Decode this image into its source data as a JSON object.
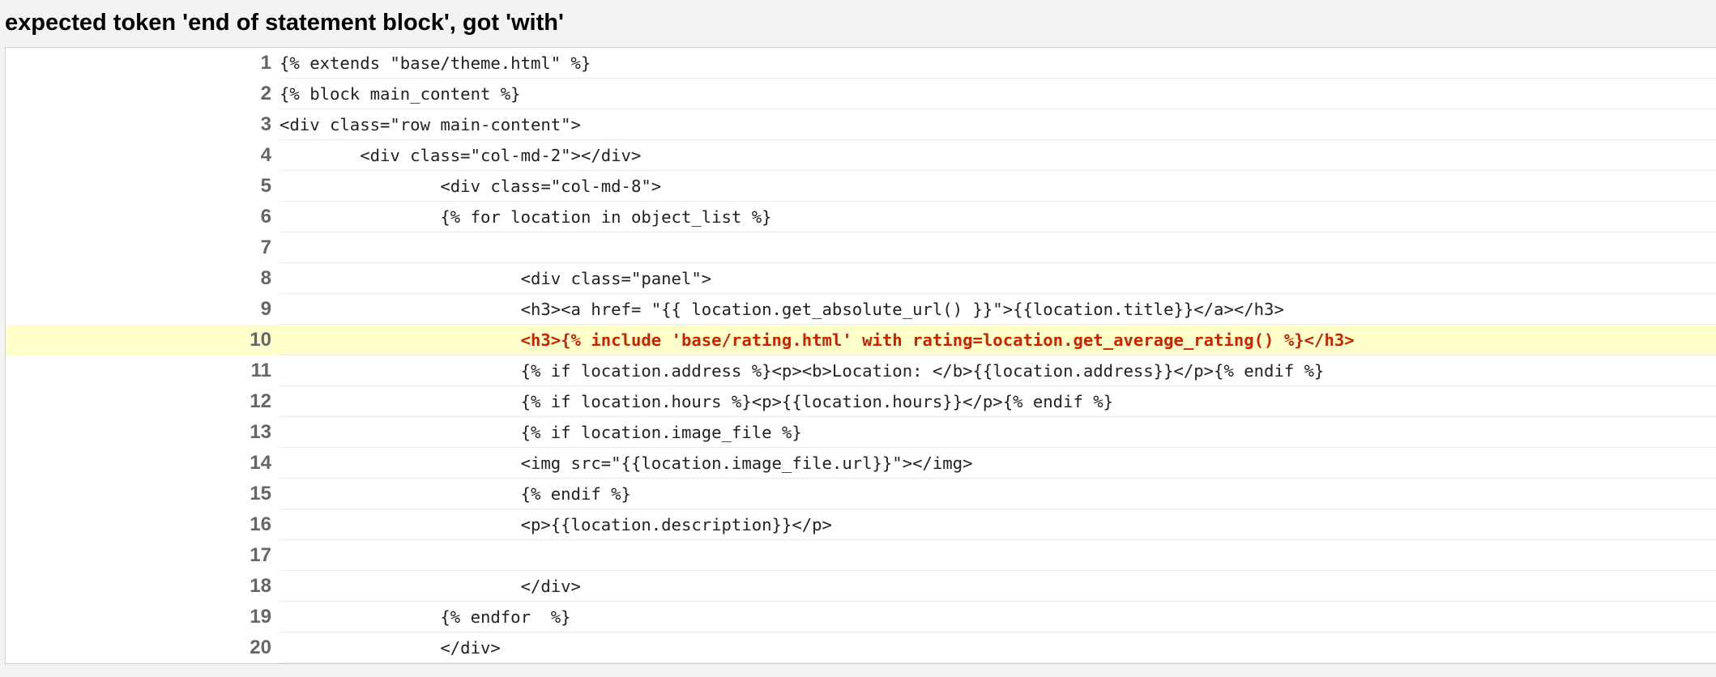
{
  "error": {
    "title": "expected token 'end of statement block', got 'with'"
  },
  "source": {
    "highlight_line": 10,
    "colors": {
      "highlight_background": "#ffffcc",
      "highlight_text": "#cc2200",
      "line_number": "#666666",
      "code_text": "#222222"
    },
    "lines": [
      {
        "number": "1",
        "code": "{% extends \"base/theme.html\" %}"
      },
      {
        "number": "2",
        "code": "{% block main_content %}"
      },
      {
        "number": "3",
        "code": "<div class=\"row main-content\">"
      },
      {
        "number": "4",
        "code": "        <div class=\"col-md-2\"></div>"
      },
      {
        "number": "5",
        "code": "                <div class=\"col-md-8\">"
      },
      {
        "number": "6",
        "code": "                {% for location in object_list %}"
      },
      {
        "number": "7",
        "code": ""
      },
      {
        "number": "8",
        "code": "                        <div class=\"panel\">"
      },
      {
        "number": "9",
        "code": "                        <h3><a href= \"{{ location.get_absolute_url() }}\">{{location.title}}</a></h3>"
      },
      {
        "number": "10",
        "code": "                        <h3>{% include 'base/rating.html' with rating=location.get_average_rating() %}</h3>"
      },
      {
        "number": "11",
        "code": "                        {% if location.address %}<p><b>Location: </b>{{location.address}}</p>{% endif %}"
      },
      {
        "number": "12",
        "code": "                        {% if location.hours %}<p>{{location.hours}}</p>{% endif %}"
      },
      {
        "number": "13",
        "code": "                        {% if location.image_file %}"
      },
      {
        "number": "14",
        "code": "                        <img src=\"{{location.image_file.url}}\"></img>"
      },
      {
        "number": "15",
        "code": "                        {% endif %}"
      },
      {
        "number": "16",
        "code": "                        <p>{{location.description}}</p>"
      },
      {
        "number": "17",
        "code": ""
      },
      {
        "number": "18",
        "code": "                        </div>"
      },
      {
        "number": "19",
        "code": "                {% endfor  %}"
      },
      {
        "number": "20",
        "code": "                </div>"
      }
    ]
  }
}
